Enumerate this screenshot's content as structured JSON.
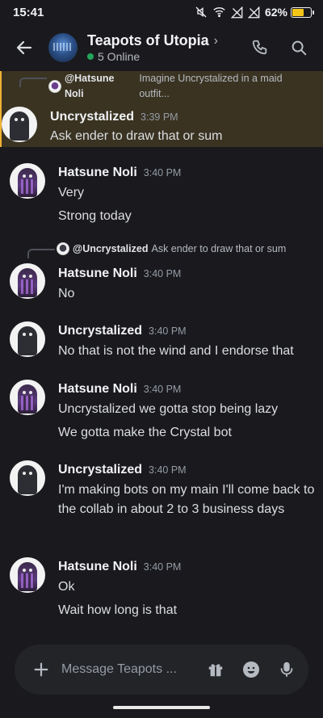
{
  "status_bar": {
    "time": "15:41",
    "battery": "62%"
  },
  "header": {
    "back_label": "back",
    "title": "Teapots of Utopia",
    "online": "5 Online"
  },
  "messages": [
    {
      "reply_to": {
        "name": "@Hatsune Noli",
        "text": "Imagine Uncrystalized in a maid outfit..."
      },
      "author": "Uncrystalized",
      "time": "3:39 PM",
      "lines": [
        "Ask ender to draw that or sum"
      ],
      "highlighted": true
    },
    {
      "author": "Hatsune Noli",
      "time": "3:40 PM",
      "lines": [
        "Very",
        "Strong today"
      ]
    },
    {
      "reply_to": {
        "name": "@Uncrystalized",
        "text": "Ask ender to draw that or sum"
      },
      "author": "Hatsune Noli",
      "time": "3:40 PM",
      "lines": [
        "No"
      ]
    },
    {
      "author": "Uncrystalized",
      "time": "3:40 PM",
      "lines": [
        "No that is not the wind and I endorse that"
      ]
    },
    {
      "author": "Hatsune Noli",
      "time": "3:40 PM",
      "lines": [
        "Uncrystalized we gotta stop being lazy",
        "We gotta make the Crystal bot"
      ]
    },
    {
      "author": "Uncrystalized",
      "time": "3:40 PM",
      "lines": [
        "I'm making bots on my main I'll come back to the collab in about 2 to 3 business days"
      ]
    },
    {
      "author": "Hatsune Noli",
      "time": "3:40 PM",
      "lines": [
        "Ok",
        "Wait how long is that"
      ]
    }
  ],
  "composer": {
    "placeholder": "Message Teapots ..."
  },
  "colors": {
    "highlight_bar": "#f0b232",
    "online": "#23a55a",
    "battery": "#f5c518"
  }
}
